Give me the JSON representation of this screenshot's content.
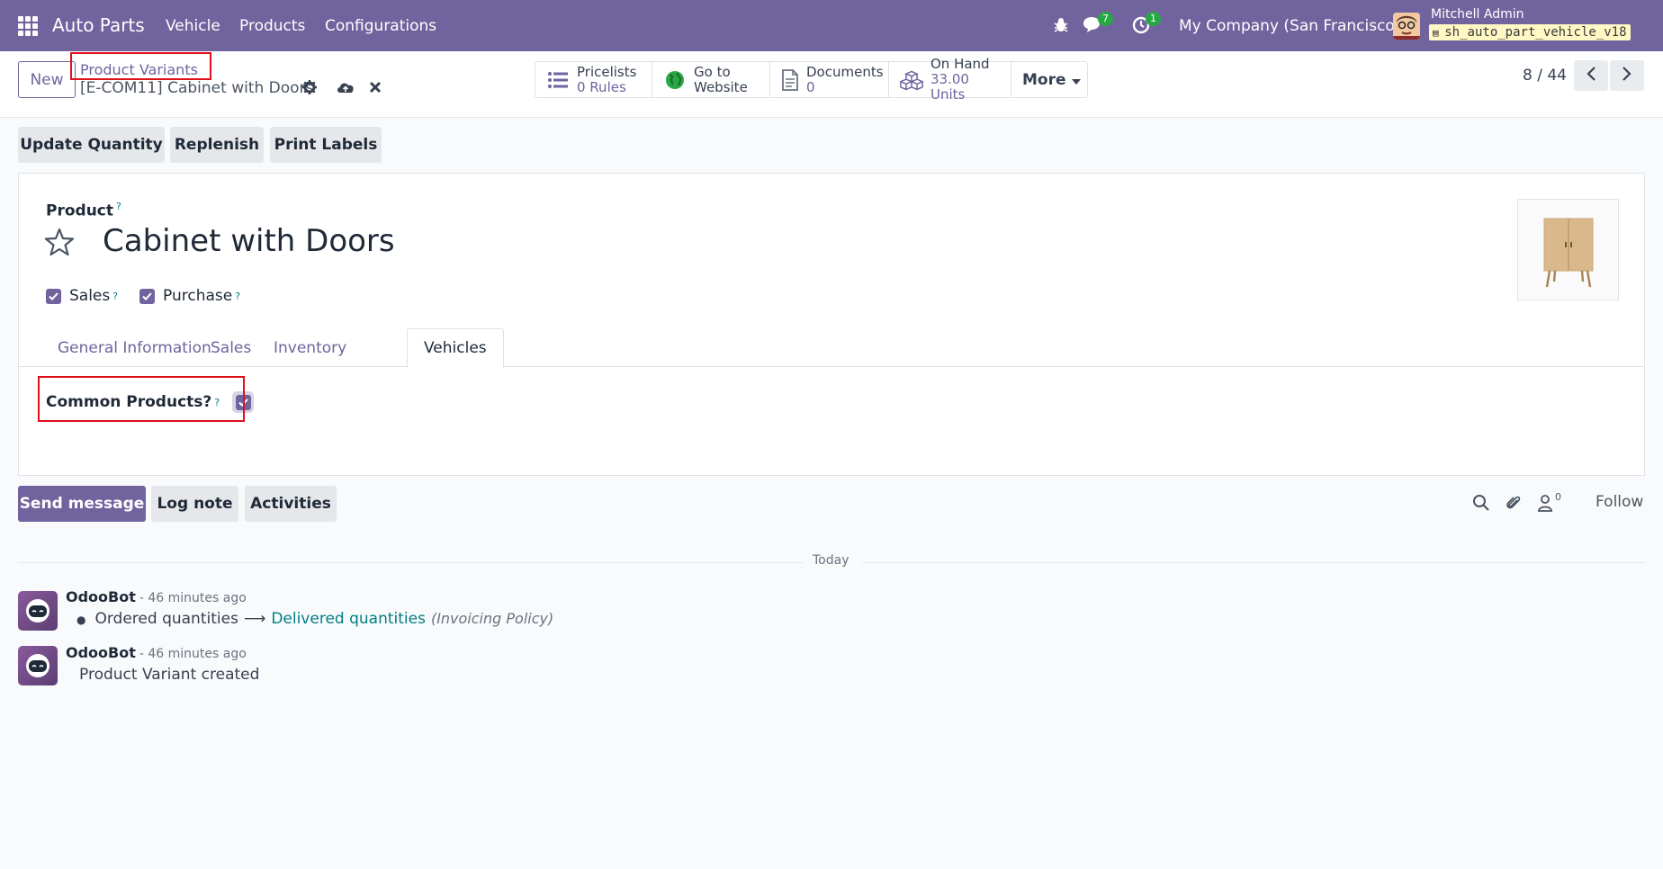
{
  "navbar": {
    "app_name": "Auto Parts",
    "menu": [
      "Vehicle",
      "Products",
      "Configurations"
    ],
    "messages_count": "7",
    "activities_count": "1",
    "company": "My Company (San Francisco)",
    "user": "Mitchell Admin",
    "database": "sh_auto_part_vehicle_v18"
  },
  "control_panel": {
    "new_label": "New",
    "breadcrumb": "Product Variants",
    "record": "[E-COM11] Cabinet with Doors",
    "stats": [
      {
        "label": "Pricelists",
        "value": "0 Rules"
      },
      {
        "label": "Go to",
        "value": "Website"
      },
      {
        "label": "Documents",
        "value": "0"
      },
      {
        "label": "On Hand",
        "value": "33.00 Units"
      }
    ],
    "more_label": "More",
    "pager": "8 / 44"
  },
  "actions": [
    "Update Quantity",
    "Replenish",
    "Print Labels"
  ],
  "form": {
    "product_label": "Product",
    "product_name": "Cabinet with Doors",
    "sales_label": "Sales",
    "purchase_label": "Purchase",
    "tabs": [
      "General Information",
      "Sales",
      "Inventory",
      "Vehicles"
    ],
    "active_tab": "Vehicles",
    "common_products_label": "Common Products?",
    "tip_mark": "?"
  },
  "chatter": {
    "send_message": "Send message",
    "log_note": "Log note",
    "activities": "Activities",
    "followers_count": "0",
    "follow_label": "Follow",
    "date_separator": "Today",
    "messages": [
      {
        "author": "OdooBot",
        "time": "- 46 minutes ago",
        "old_value": "Ordered quantities",
        "new_value": "Delivered quantities",
        "field": "(Invoicing Policy)"
      },
      {
        "author": "OdooBot",
        "time": "- 46 minutes ago",
        "body": "Product Variant created"
      }
    ]
  },
  "colors": {
    "brand": "#71639e",
    "highlight": "#e0101a",
    "badge": "#28a745",
    "link": "#017e84"
  }
}
